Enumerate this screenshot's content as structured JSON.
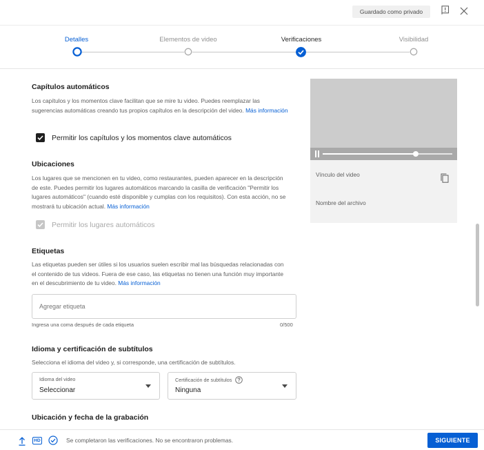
{
  "header": {
    "saved_chip": "Guardado como privado"
  },
  "stepper": {
    "steps": [
      {
        "label": "Detalles",
        "state": "current"
      },
      {
        "label": "Elementos de video",
        "state": "pending"
      },
      {
        "label": "Verificaciones",
        "state": "done"
      },
      {
        "label": "Visibilidad",
        "state": "pending"
      }
    ]
  },
  "chapters": {
    "title": "Capítulos automáticos",
    "desc": "Los capítulos y los momentos clave facilitan que se mire tu video. Puedes reemplazar las sugerencias automáticas creando tus propios capítulos en la descripción del video.",
    "link": "Más información",
    "checkbox_label": "Permitir los capítulos y los momentos clave automáticos",
    "checked": true
  },
  "locations": {
    "title": "Ubicaciones",
    "desc": "Los lugares que se mencionen en tu video, como restaurantes, pueden aparecer en la descripción de este. Puedes permitir los lugares automáticos marcando la casilla de verificación \"Permitir los lugares automáticos\" (cuando esté disponible y cumplas con los requisitos). Con esta acción, no se mostrará tu ubicación actual.",
    "link": "Más información",
    "checkbox_label": "Permitir los lugares automáticos",
    "checked": true,
    "disabled": true
  },
  "tags": {
    "title": "Etiquetas",
    "desc": "Las etiquetas pueden ser útiles si los usuarios suelen escribir mal las búsquedas relacionadas con el contenido de tus videos. Fuera de ese caso, las etiquetas no tienen una función muy importante en el descubrimiento de tu video.",
    "link": "Más información",
    "placeholder": "Agregar etiqueta",
    "hint": "Ingresa una coma después de cada etiqueta",
    "counter": "0/500"
  },
  "subtitles": {
    "title": "Idioma y certificación de subtítulos",
    "desc": "Selecciona el idioma del video y, si corresponde, una certificación de subtítulos.",
    "language_label": "Idioma del video",
    "language_value": "Seleccionar",
    "cert_label": "Certificación de subtítulos",
    "cert_value": "Ninguna"
  },
  "recording": {
    "title": "Ubicación y fecha de la grabación"
  },
  "preview": {
    "video_link_label": "Vínculo del video",
    "filename_label": "Nombre del archivo",
    "playback_progress": 0.72
  },
  "footer": {
    "hd_badge": "HD",
    "status": "Se completaron las verificaciones. No se encontraron problemas.",
    "next_button": "SIGUIENTE"
  },
  "colors": {
    "accent": "#065fd4",
    "checkbox": "#1f1f1f",
    "disabled": "#c6c6c6"
  }
}
